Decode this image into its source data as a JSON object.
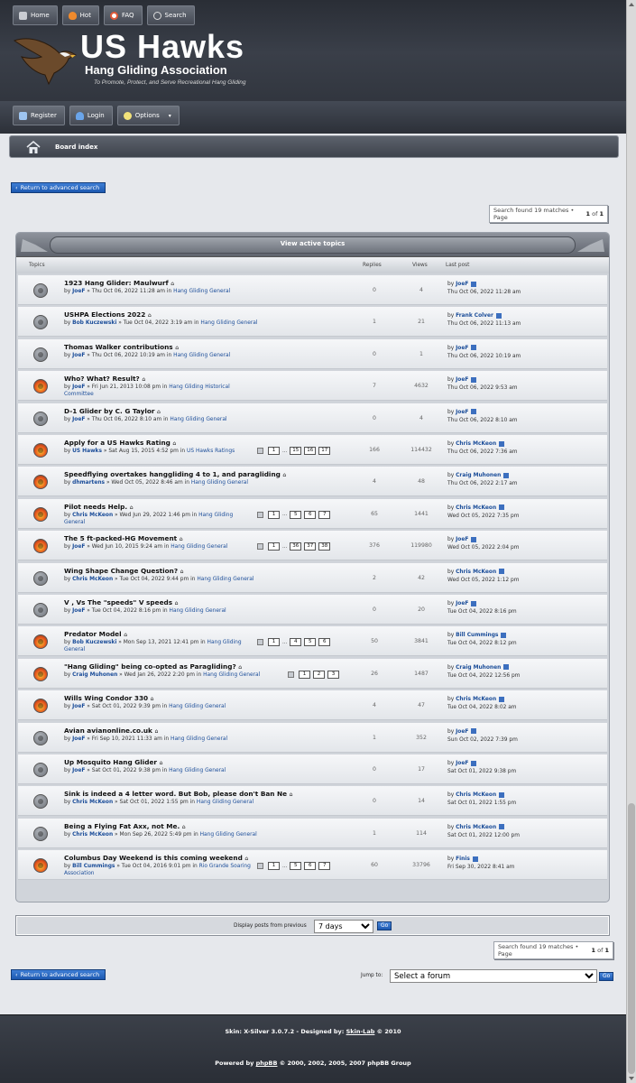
{
  "nav": {
    "home": "Home",
    "hot": "Hot",
    "faq": "FAQ",
    "search": "Search"
  },
  "logo": {
    "title": "US Hawks",
    "subtitle": "Hang Gliding Association",
    "tagline": "To Promote, Protect, and Serve Recreational Hang Gliding"
  },
  "subnav": {
    "register": "Register",
    "login": "Login",
    "options": "Options"
  },
  "breadcrumb": {
    "label": "Board index"
  },
  "return_link": "Return to advanced search",
  "search_summary": {
    "prefix": "Search found 19 matches • Page",
    "page": "1",
    "of": "of",
    "total": "1"
  },
  "box_title": "View active topics",
  "columns": {
    "topics": "Topics",
    "replies": "Replies",
    "views": "Views",
    "lastpost": "Last post"
  },
  "by": "by",
  "topics": [
    {
      "title": "1923 Hang Glider: Maulwurf",
      "author": "JoeF",
      "date": "» Thu Oct 06, 2022 11:28 am in",
      "forum": "Hang Gliding General",
      "pages": [],
      "replies": "0",
      "views": "4",
      "last_author": "JoeF",
      "last_date": "Thu Oct 06, 2022 11:28 am",
      "hot": false
    },
    {
      "title": "USHPA Elections 2022",
      "author": "Bob Kuczewski",
      "date": "» Tue Oct 04, 2022 3:19 am in",
      "forum": "Hang Gliding General",
      "pages": [],
      "replies": "1",
      "views": "21",
      "last_author": "Frank Colver",
      "last_date": "Thu Oct 06, 2022 11:13 am",
      "hot": false
    },
    {
      "title": "Thomas Walker contributions",
      "author": "JoeF",
      "date": "» Thu Oct 06, 2022 10:19 am in",
      "forum": "Hang Gliding General",
      "pages": [],
      "replies": "0",
      "views": "1",
      "last_author": "JoeF",
      "last_date": "Thu Oct 06, 2022 10:19 am",
      "hot": false
    },
    {
      "title": "Who? What? Result?",
      "author": "JoeF",
      "date": "» Fri Jun 21, 2013 10:08 pm in",
      "forum": "Hang Gliding Historical Committee",
      "pages": [],
      "replies": "7",
      "views": "4632",
      "last_author": "JoeF",
      "last_date": "Thu Oct 06, 2022 9:53 am",
      "hot": true
    },
    {
      "title": "D-1 Glider by C. G Taylor",
      "author": "JoeF",
      "date": "» Thu Oct 06, 2022 8:10 am in",
      "forum": "Hang Gliding General",
      "pages": [],
      "replies": "0",
      "views": "4",
      "last_author": "JoeF",
      "last_date": "Thu Oct 06, 2022 8:10 am",
      "hot": false
    },
    {
      "title": "Apply for a US Hawks Rating",
      "author": "US Hawks",
      "date": "» Sat Aug 15, 2015 4:52 pm in",
      "forum": "US Hawks Ratings",
      "pages": [
        "1",
        "...",
        "15",
        "16",
        "17"
      ],
      "replies": "166",
      "views": "114432",
      "last_author": "Chris McKeon",
      "last_date": "Thu Oct 06, 2022 7:36 am",
      "hot": true
    },
    {
      "title": "Speedflying overtakes hanggliding 4 to 1, and paragliding",
      "author": "dhmartens",
      "date": "» Wed Oct 05, 2022 8:46 am in",
      "forum": "Hang Gliding General",
      "pages": [],
      "replies": "4",
      "views": "48",
      "last_author": "Craig Muhonen",
      "last_date": "Thu Oct 06, 2022 2:17 am",
      "hot": true
    },
    {
      "title": "Pilot needs Help.",
      "author": "Chris McKeon",
      "date": "» Wed Jun 29, 2022 1:46 pm in",
      "forum": "Hang Gliding General",
      "pages": [
        "1",
        "...",
        "5",
        "6",
        "7"
      ],
      "replies": "65",
      "views": "1441",
      "last_author": "Chris McKeon",
      "last_date": "Wed Oct 05, 2022 7:35 pm",
      "hot": true
    },
    {
      "title": "The 5 ft-packed-HG Movement",
      "author": "JoeF",
      "date": "» Wed Jun 10, 2015 9:24 am in",
      "forum": "Hang Gliding General",
      "pages": [
        "1",
        "...",
        "36",
        "37",
        "38"
      ],
      "replies": "376",
      "views": "119980",
      "last_author": "JoeF",
      "last_date": "Wed Oct 05, 2022 2:04 pm",
      "hot": true
    },
    {
      "title": "Wing Shape Change Question?",
      "author": "Chris McKeon",
      "date": "» Tue Oct 04, 2022 9:44 pm in",
      "forum": "Hang Gliding General",
      "pages": [],
      "replies": "2",
      "views": "42",
      "last_author": "Chris McKeon",
      "last_date": "Wed Oct 05, 2022 1:12 pm",
      "hot": false
    },
    {
      "title": "V , Vs The \"speeds\" V speeds",
      "author": "JoeF",
      "date": "» Tue Oct 04, 2022 8:16 pm in",
      "forum": "Hang Gliding General",
      "pages": [],
      "replies": "0",
      "views": "20",
      "last_author": "JoeF",
      "last_date": "Tue Oct 04, 2022 8:16 pm",
      "hot": false
    },
    {
      "title": "Predator Model",
      "author": "Bob Kuczewski",
      "date": "» Mon Sep 13, 2021 12:41 pm in",
      "forum": "Hang Gliding General",
      "pages": [
        "1",
        "...",
        "4",
        "5",
        "6"
      ],
      "replies": "50",
      "views": "3841",
      "last_author": "Bill Cummings",
      "last_date": "Tue Oct 04, 2022 8:12 pm",
      "hot": true
    },
    {
      "title": "\"Hang Gliding\" being co-opted as Paragliding?",
      "author": "Craig Muhonen",
      "date": "» Wed Jan 26, 2022 2:20 pm in",
      "forum": "Hang Gliding General",
      "pages": [
        "1",
        "2",
        "3"
      ],
      "replies": "26",
      "views": "1487",
      "last_author": "Craig Muhonen",
      "last_date": "Tue Oct 04, 2022 12:56 pm",
      "hot": true
    },
    {
      "title": "Wills Wing Condor 330",
      "author": "JoeF",
      "date": "» Sat Oct 01, 2022 9:39 pm in",
      "forum": "Hang Gliding General",
      "pages": [],
      "replies": "4",
      "views": "47",
      "last_author": "Chris McKeon",
      "last_date": "Tue Oct 04, 2022 8:02 am",
      "hot": true
    },
    {
      "title": "Avian avianonline.co.uk",
      "author": "JoeF",
      "date": "» Fri Sep 10, 2021 11:33 am in",
      "forum": "Hang Gliding General",
      "pages": [],
      "replies": "1",
      "views": "352",
      "last_author": "JoeF",
      "last_date": "Sun Oct 02, 2022 7:39 pm",
      "hot": false
    },
    {
      "title": "Up Mosquito Hang Glider",
      "author": "JoeF",
      "date": "» Sat Oct 01, 2022 9:38 pm in",
      "forum": "Hang Gliding General",
      "pages": [],
      "replies": "0",
      "views": "17",
      "last_author": "JoeF",
      "last_date": "Sat Oct 01, 2022 9:38 pm",
      "hot": false
    },
    {
      "title": "Sink is indeed a 4 letter word. But Bob, please don't Ban Ne",
      "author": "Chris McKeon",
      "date": "» Sat Oct 01, 2022 1:55 pm in",
      "forum": "Hang Gliding General",
      "pages": [],
      "replies": "0",
      "views": "14",
      "last_author": "Chris McKeon",
      "last_date": "Sat Oct 01, 2022 1:55 pm",
      "hot": false
    },
    {
      "title": "Being a Flying Fat Axx, not Me.",
      "author": "Chris McKeon",
      "date": "» Mon Sep 26, 2022 5:49 pm in",
      "forum": "Hang Gliding General",
      "pages": [],
      "replies": "1",
      "views": "114",
      "last_author": "Chris McKeon",
      "last_date": "Sat Oct 01, 2022 12:00 pm",
      "hot": false
    },
    {
      "title": "Columbus Day Weekend is this coming weekend",
      "author": "Bill Cummings",
      "date": "» Tue Oct 04, 2016 9:01 pm in",
      "forum": "Rio Grande Soaring Association",
      "pages": [
        "1",
        "...",
        "5",
        "6",
        "7"
      ],
      "replies": "60",
      "views": "33796",
      "last_author": "Finis",
      "last_date": "Fri Sep 30, 2022 8:41 am",
      "hot": true
    }
  ],
  "display": {
    "label": "Display posts from previous",
    "selected": "7 days",
    "go": "Go"
  },
  "jump": {
    "label": "Jump to:",
    "selected": "Select a forum",
    "go": "Go"
  },
  "footer": {
    "skin_prefix": "Skin: X-Silver 3.0.7.2 - Designed by:",
    "skin_link": "Skin-Lab",
    "skin_suffix": "© 2010",
    "powered_prefix": "Powered by",
    "powered_link": "phpBB",
    "powered_suffix": "© 2000, 2002, 2005, 2007 phpBB Group"
  },
  "colors": {
    "accent": "#1c58b0",
    "header": "#2c3038",
    "link": "#1b4d99"
  }
}
